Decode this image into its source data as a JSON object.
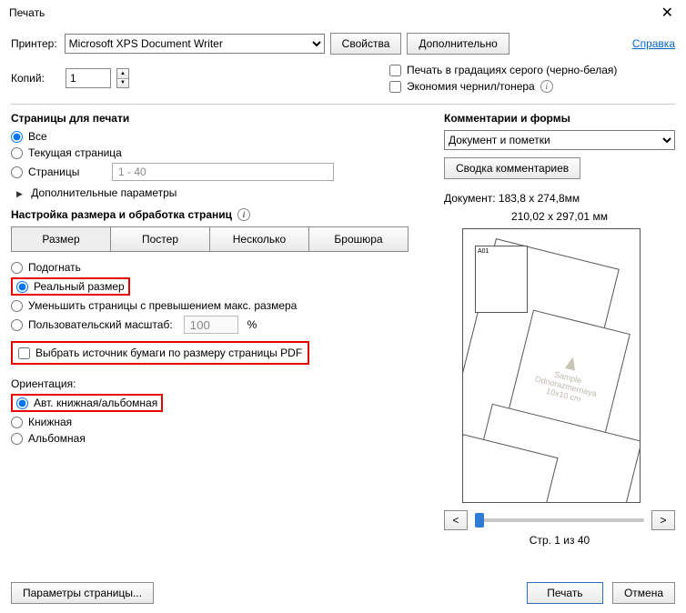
{
  "title": "Печать",
  "help_link": "Справка",
  "printer": {
    "label": "Принтер:",
    "value": "Microsoft XPS Document Writer",
    "props_btn": "Свойства",
    "advanced_btn": "Дополнительно"
  },
  "copies": {
    "label": "Копий:",
    "value": "1"
  },
  "grayscale": "Печать в градациях серого (черно-белая)",
  "ink_saving": "Экономия чернил/тонера",
  "pages": {
    "header": "Страницы для печати",
    "all": "Все",
    "current": "Текущая страница",
    "range": "Страницы",
    "range_value": "1 - 40",
    "more": "Дополнительные параметры"
  },
  "sizing": {
    "header": "Настройка размера и обработка страниц",
    "btn_size": "Размер",
    "btn_poster": "Постер",
    "btn_multi": "Несколько",
    "btn_booklet": "Брошюра",
    "fit": "Подогнать",
    "actual": "Реальный размер",
    "shrink": "Уменьшить страницы с превышением макс. размера",
    "custom": "Пользовательский масштаб:",
    "custom_value": "100",
    "percent": "%",
    "paper_source": "Выбрать источник бумаги по размеру страницы PDF"
  },
  "orientation": {
    "header": "Ориентация:",
    "auto": "Авт. книжная/альбомная",
    "portrait": "Книжная",
    "landscape": "Альбомная"
  },
  "comments": {
    "header": "Комментарии и формы",
    "value": "Документ и пометки",
    "summary_btn": "Сводка комментариев"
  },
  "document": {
    "label": "Документ: 183,8 x 274,8мм",
    "paper": "210,02 x 297,01 мм",
    "page_label_small": "A01",
    "sample1": "Sample",
    "sample2": "Odnorazmernaya",
    "sample3": "10x10 cm",
    "page_of": "Стр. 1 из 40"
  },
  "footer": {
    "page_setup": "Параметры страницы...",
    "print": "Печать",
    "cancel": "Отмена"
  },
  "nav": {
    "prev": "<",
    "next": ">"
  }
}
